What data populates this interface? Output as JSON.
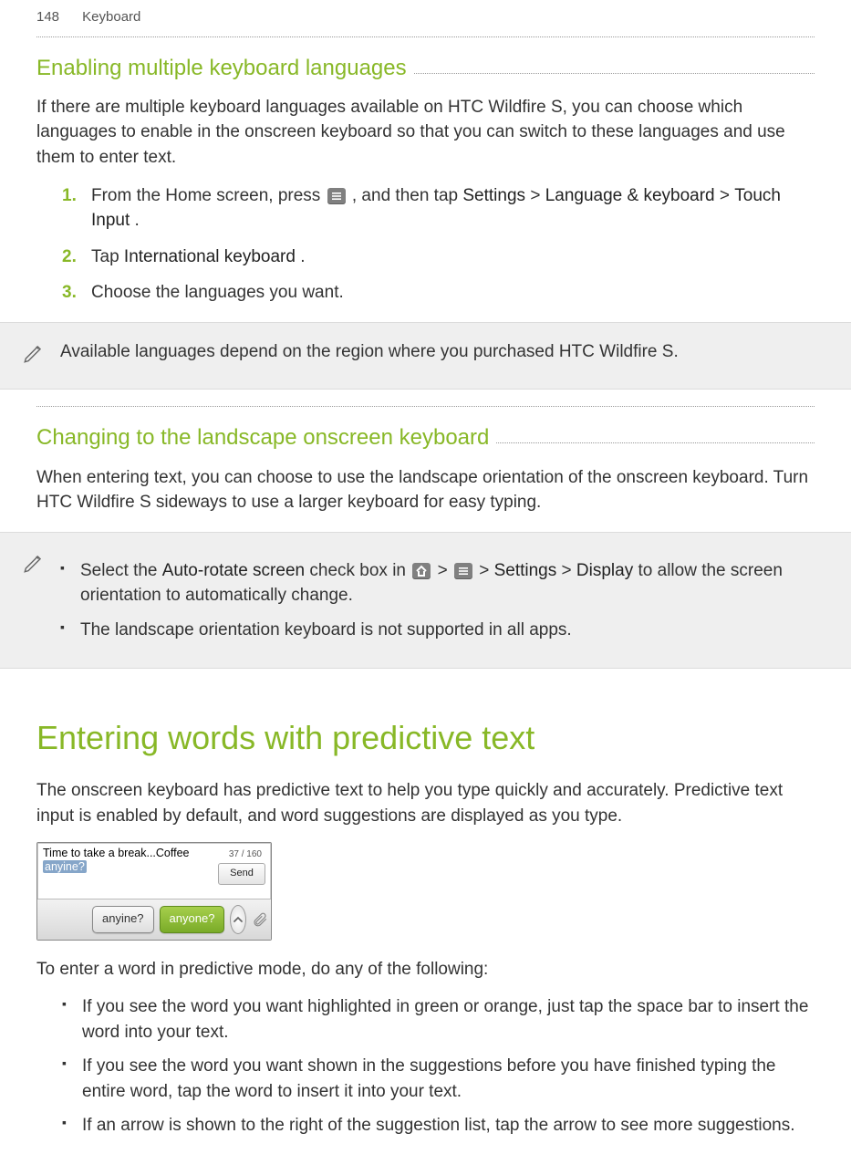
{
  "header": {
    "page_number": "148",
    "section": "Keyboard"
  },
  "sec1": {
    "title": "Enabling multiple keyboard languages",
    "intro": "If there are multiple keyboard languages available on HTC Wildfire S, you can choose which languages to enable in the onscreen keyboard so that you can switch to these languages and use them to enter text.",
    "step1_a": "From the Home screen, press ",
    "step1_b": ", and then tap ",
    "s_settings": "Settings",
    "s_gt1": " > ",
    "s_lang": "Language & keyboard",
    "s_gt2": " > ",
    "s_touch": "Touch Input",
    "s_dot": ".",
    "step2_a": "Tap ",
    "step2_b": "International keyboard",
    "step2_c": ".",
    "step3": "Choose the languages you want.",
    "note": "Available languages depend on the region where you purchased HTC Wildfire S."
  },
  "sec2": {
    "title": "Changing to the landscape onscreen keyboard",
    "intro": "When entering text, you can choose to use the landscape orientation of the onscreen keyboard. Turn HTC Wildfire S sideways to use a larger keyboard for easy typing.",
    "b1_a": "Select the ",
    "b1_b": "Auto-rotate screen",
    "b1_c": " check box in ",
    "gt1": " > ",
    "gt2": " > ",
    "b1_settings": "Settings",
    "gt3": " > ",
    "b1_display": "Display",
    "b1_d": " to allow the screen orientation to automatically change.",
    "b2": "The landscape orientation keyboard is not supported in all apps."
  },
  "sec3": {
    "title": "Entering words with predictive text",
    "intro": "The onscreen keyboard has predictive text to help you type quickly and accurately. Predictive text input is enabled by default, and word suggestions are displayed as you type.",
    "screenshot": {
      "text_line": "Time to take a break...Coffee ",
      "highlight": "anyine?",
      "counter": "37 / 160",
      "send": "Send",
      "chip1": "anyine?",
      "chip2": "anyone?"
    },
    "lead": "To enter a word in predictive mode, do any of the following:",
    "b1": "If you see the word you want highlighted in green or orange, just tap the space bar to insert the word into your text.",
    "b2": "If you see the word you want shown in the suggestions before you have finished typing the entire word, tap the word to insert it into your text.",
    "b3": "If an arrow is shown to the right of the suggestion list, tap the arrow to see more suggestions."
  }
}
